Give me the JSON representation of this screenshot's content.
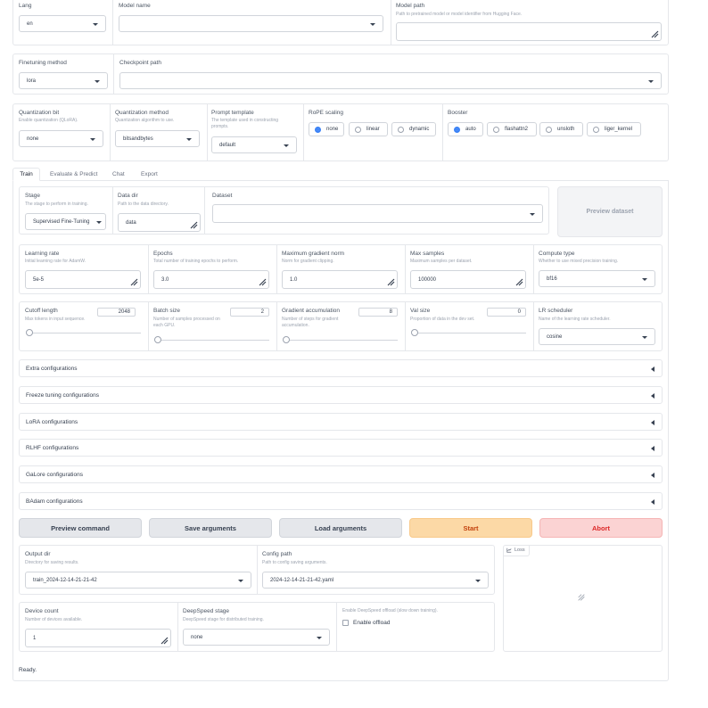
{
  "top": {
    "lang": {
      "label": "Lang",
      "value": "en"
    },
    "model_name": {
      "label": "Model name",
      "value": ""
    },
    "model_path": {
      "label": "Model path",
      "info": "Path to pretrained model or model identifier from Hugging Face.",
      "value": ""
    }
  },
  "finetune": {
    "method": {
      "label": "Finetuning method",
      "value": "lora"
    },
    "checkpoint": {
      "label": "Checkpoint path",
      "value": ""
    }
  },
  "quant": {
    "bit": {
      "label": "Quantization bit",
      "info": "Enable quantization (QLoRA).",
      "value": "none"
    },
    "method": {
      "label": "Quantization method",
      "info": "Quantization algorithm to use.",
      "value": "bitsandbytes"
    },
    "template": {
      "label": "Prompt template",
      "info1": "The template used in constructing",
      "info2": "prompts.",
      "value": "default"
    },
    "rope": {
      "label": "RoPE scaling",
      "options": [
        "none",
        "linear",
        "dynamic"
      ],
      "selected": "none"
    },
    "booster": {
      "label": "Booster",
      "options": [
        "auto",
        "flashattn2",
        "unsloth",
        "liger_kernel"
      ],
      "selected": "auto"
    }
  },
  "tabs": [
    "Train",
    "Evaluate & Predict",
    "Chat",
    "Export"
  ],
  "active_tab": "Train",
  "train": {
    "stage": {
      "label": "Stage",
      "info": "The stage to perform in training.",
      "value": "Supervised Fine-Tuning"
    },
    "data_dir": {
      "label": "Data dir",
      "info": "Path to the data directory.",
      "value": "data"
    },
    "dataset": {
      "label": "Dataset",
      "value": ""
    },
    "preview_dataset": "Preview dataset",
    "learning_rate": {
      "label": "Learning rate",
      "info": "Initial learning rate for AdamW.",
      "value": "5e-5"
    },
    "epochs": {
      "label": "Epochs",
      "info": "Total number of training epochs to perform.",
      "value": "3.0"
    },
    "max_grad_norm": {
      "label": "Maximum gradient norm",
      "info": "Norm for gradient clipping.",
      "value": "1.0"
    },
    "max_samples": {
      "label": "Max samples",
      "info": "Maximum samples per dataset.",
      "value": "100000"
    },
    "compute_type": {
      "label": "Compute type",
      "info": "Whether to use mixed precision training.",
      "value": "bf16"
    },
    "cutoff": {
      "label": "Cutoff length",
      "info": "Max tokens in input sequence.",
      "value": "2048"
    },
    "batch_size": {
      "label": "Batch size",
      "info1": "Number of samples processed on",
      "info2": "each GPU.",
      "value": "2"
    },
    "grad_accum": {
      "label": "Gradient accumulation",
      "info1": "Number of steps for gradient",
      "info2": "accumulation.",
      "value": "8"
    },
    "val_size": {
      "label": "Val size",
      "info": "Proportion of data in the dev set.",
      "value": "0"
    },
    "lr_scheduler": {
      "label": "LR scheduler",
      "info": "Name of the learning rate scheduler.",
      "value": "cosine"
    },
    "accordions": [
      "Extra configurations",
      "Freeze tuning configurations",
      "LoRA configurations",
      "RLHF configurations",
      "GaLore configurations",
      "BAdam configurations"
    ],
    "buttons": {
      "preview": "Preview command",
      "save": "Save arguments",
      "load": "Load arguments",
      "start": "Start",
      "abort": "Abort"
    },
    "output_dir": {
      "label": "Output dir",
      "info": "Directory for saving results.",
      "value": "train_2024-12-14-21-21-42"
    },
    "config_path": {
      "label": "Config path",
      "info": "Path to config saving arguments.",
      "value": "2024-12-14-21-21-42.yaml"
    },
    "device_count": {
      "label": "Device count",
      "info": "Number of devices available.",
      "value": "1"
    },
    "deepspeed": {
      "label": "DeepSpeed stage",
      "info": "DeepSpeed stage for distributed training.",
      "value": "none"
    },
    "offload": {
      "info": "Enable DeepSpeed offload (slow down training).",
      "label": "Enable offload"
    },
    "loss_label": "Loss",
    "status": "Ready."
  }
}
